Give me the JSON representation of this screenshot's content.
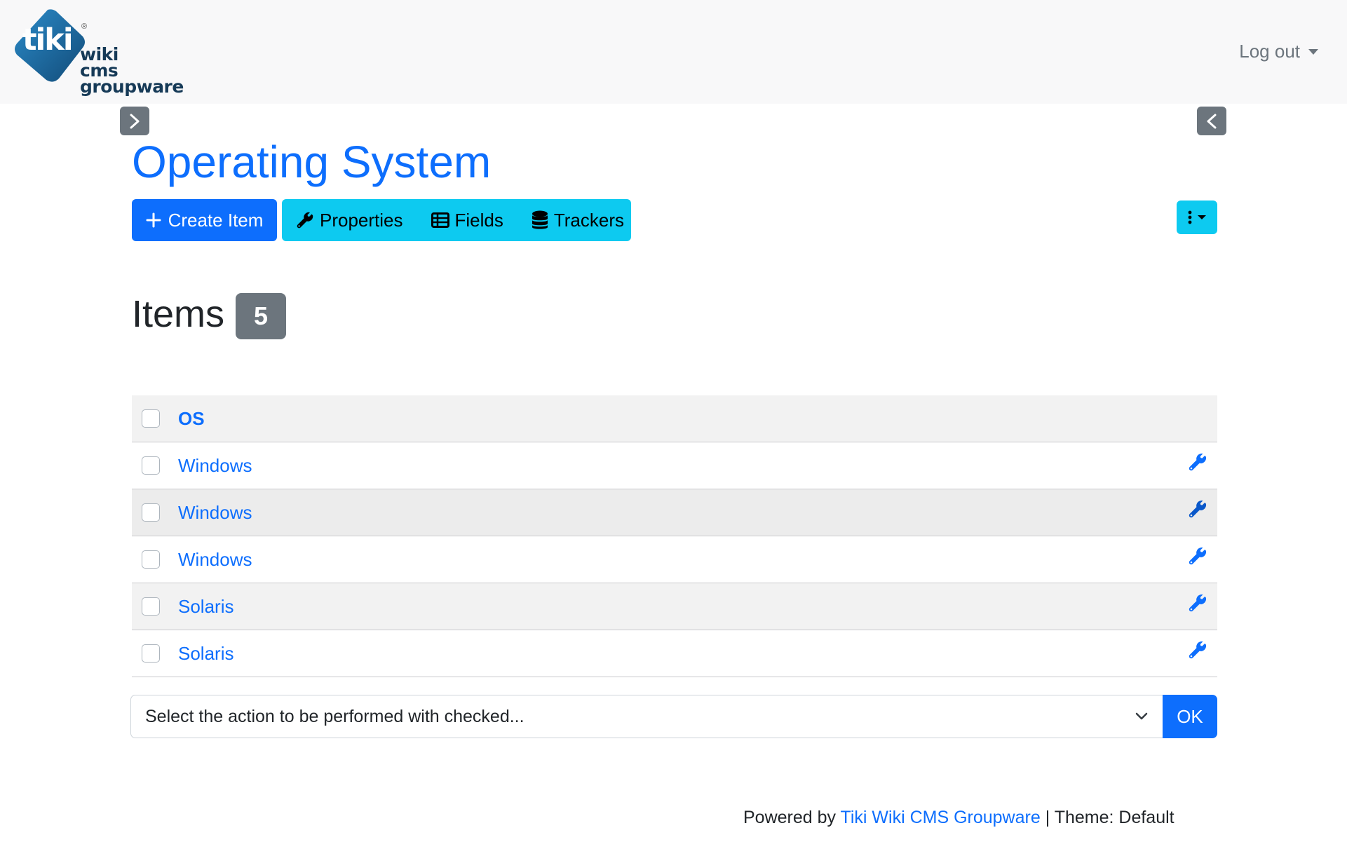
{
  "header": {
    "logo": {
      "wordmark": "tiki",
      "registered": "®",
      "tagline": [
        "wiki",
        "cms",
        "groupware"
      ]
    },
    "logout_label": "Log out"
  },
  "page_title": "Operating System",
  "toolbar": {
    "create_label": "Create Item",
    "properties_label": "Properties",
    "fields_label": "Fields",
    "trackers_label": "Trackers"
  },
  "items": {
    "heading": "Items",
    "count": "5"
  },
  "table": {
    "column_header": "OS",
    "rows": [
      {
        "value": "Windows"
      },
      {
        "value": "Windows"
      },
      {
        "value": "Windows"
      },
      {
        "value": "Solaris"
      },
      {
        "value": "Solaris"
      }
    ]
  },
  "bulk_action": {
    "select_text": "Select the action to be performed with checked...",
    "ok_label": "OK"
  },
  "footer": {
    "powered_by": "Powered by",
    "link_text": "Tiki Wiki CMS Groupware",
    "theme_text": "| Theme: Default"
  },
  "colors": {
    "primary": "#0d6efd",
    "info": "#0dcaf0",
    "secondary": "#6c757d",
    "logo_blue": "#1f6fa8"
  }
}
